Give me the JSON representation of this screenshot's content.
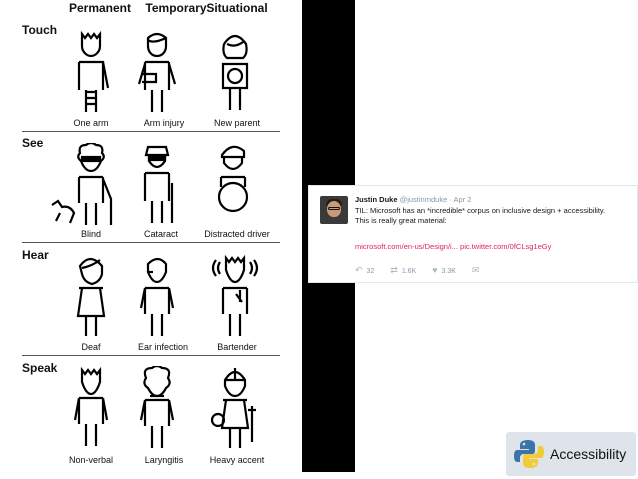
{
  "spectrum": {
    "columns": [
      "Permanent",
      "Temporary",
      "Situational"
    ],
    "rows": [
      {
        "label": "Touch",
        "captions": [
          "One arm",
          "Arm injury",
          "New parent"
        ]
      },
      {
        "label": "See",
        "captions": [
          "Blind",
          "Cataract",
          "Distracted driver"
        ]
      },
      {
        "label": "Hear",
        "captions": [
          "Deaf",
          "Ear infection",
          "Bartender"
        ]
      },
      {
        "label": "Speak",
        "captions": [
          "Non-verbal",
          "Laryngitis",
          "Heavy accent"
        ]
      }
    ]
  },
  "tweet": {
    "name": "Justin Duke",
    "handle": "@justinmduke",
    "separator": "·",
    "date": "Apr 2",
    "line1": "TIL: Microsoft has an *incredible* corpus on inclusive design + accessibility.",
    "line2": "This is really great material:",
    "link1": "microsoft.com/en-us/Design/i...",
    "link2": "pic.twitter.com/0fCLsg1eGy",
    "reply_count": "32",
    "retweet_count": "1.6K",
    "like_count": "3.3K",
    "icons": [
      "reply-icon",
      "retweet-icon",
      "heart-icon",
      "message-icon"
    ]
  },
  "badge": {
    "label": "Accessibility",
    "logo": "python-logo",
    "colors": {
      "blue": "#3b74a8",
      "yellow": "#f2cc36"
    }
  }
}
